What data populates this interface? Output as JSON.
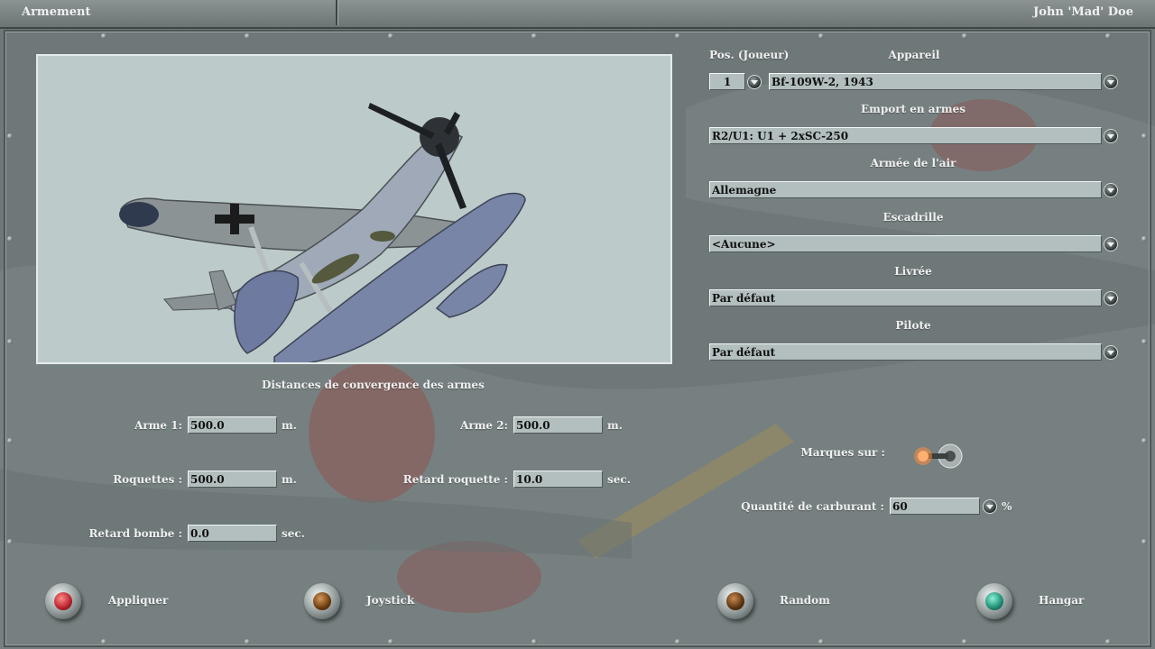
{
  "header": {
    "title": "Armement",
    "user": "John 'Mad' Doe"
  },
  "convergence": {
    "title": "Distances de convergence des armes",
    "weapon1": {
      "label": "Arme 1:",
      "value": "500.0",
      "unit": "m."
    },
    "weapon2": {
      "label": "Arme 2:",
      "value": "500.0",
      "unit": "m."
    },
    "rockets": {
      "label": "Roquettes :",
      "value": "500.0",
      "unit": "m."
    },
    "rocket_delay": {
      "label": "Retard roquette :",
      "value": "10.0",
      "unit": "sec."
    },
    "bomb_delay": {
      "label": "Retard bombe :",
      "value": "0.0",
      "unit": "sec."
    }
  },
  "loadout": {
    "position_label": "Pos. (Joueur)",
    "position_value": "1",
    "aircraft_label": "Appareil",
    "aircraft_value": "Bf-109W-2, 1943",
    "weapons_label": "Emport en armes",
    "weapons_value": "R2/U1: U1 + 2xSC-250",
    "airforce_label": "Armée de l'air",
    "airforce_value": "Allemagne",
    "squadron_label": "Escadrille",
    "squadron_value": "<Aucune>",
    "skin_label": "Livrée",
    "skin_value": "Par défaut",
    "pilot_label": "Pilote",
    "pilot_value": "Par défaut",
    "markings_label": "Marques sur :",
    "markings_on": true,
    "fuel_label": "Quantité de carburant :",
    "fuel_value": "60",
    "fuel_unit": "%"
  },
  "buttons": {
    "apply": "Appliquer",
    "joystick": "Joystick",
    "random": "Random",
    "hangar": "Hangar"
  },
  "colors": {
    "apply_lamp": "#b8202a",
    "joystick_lamp": "#6b3a10",
    "random_lamp": "#5a3410",
    "hangar_lamp": "#1f8a72"
  }
}
